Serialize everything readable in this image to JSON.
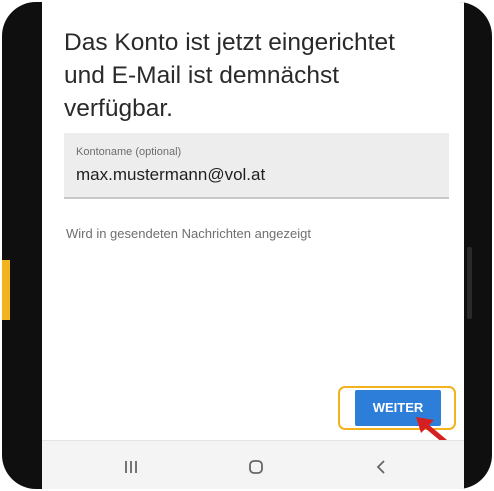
{
  "screen": {
    "title": "Das Konto ist jetzt eingerichtet\nund E-Mail ist demnächst\nverfügbar.",
    "account_field": {
      "label": "Kontoname (optional)",
      "value": "max.mustermann@vol.at"
    },
    "helper_text": "Wird in gesendeten Nachrichten angezeigt",
    "next_button_label": "WEITER"
  },
  "nav_bar": {
    "icons": [
      "recent-apps-icon",
      "home-icon",
      "back-icon"
    ]
  },
  "colors": {
    "accent_highlight": "#f3b31d",
    "button_blue": "#2d7ed9",
    "arrow_red": "#d42020",
    "frame": "#0f0f0f"
  }
}
